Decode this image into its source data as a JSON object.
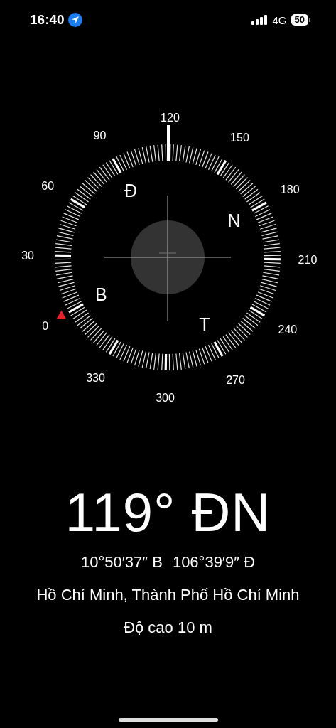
{
  "status_bar": {
    "time": "16:40",
    "network": "4G",
    "battery": "50"
  },
  "compass": {
    "degree_labels": [
      "0",
      "30",
      "60",
      "90",
      "120",
      "150",
      "180",
      "210",
      "240",
      "270",
      "300",
      "330"
    ],
    "direction_labels": [
      "B",
      "Đ",
      "N",
      "T"
    ]
  },
  "heading": "119° ĐN",
  "coordinates": {
    "latitude": "10°50′37″ B",
    "longitude": "106°39′9″ Đ"
  },
  "location": "Hồ Chí Minh, Thành Phố Hồ Chí Minh",
  "altitude": "Độ cao 10 m"
}
